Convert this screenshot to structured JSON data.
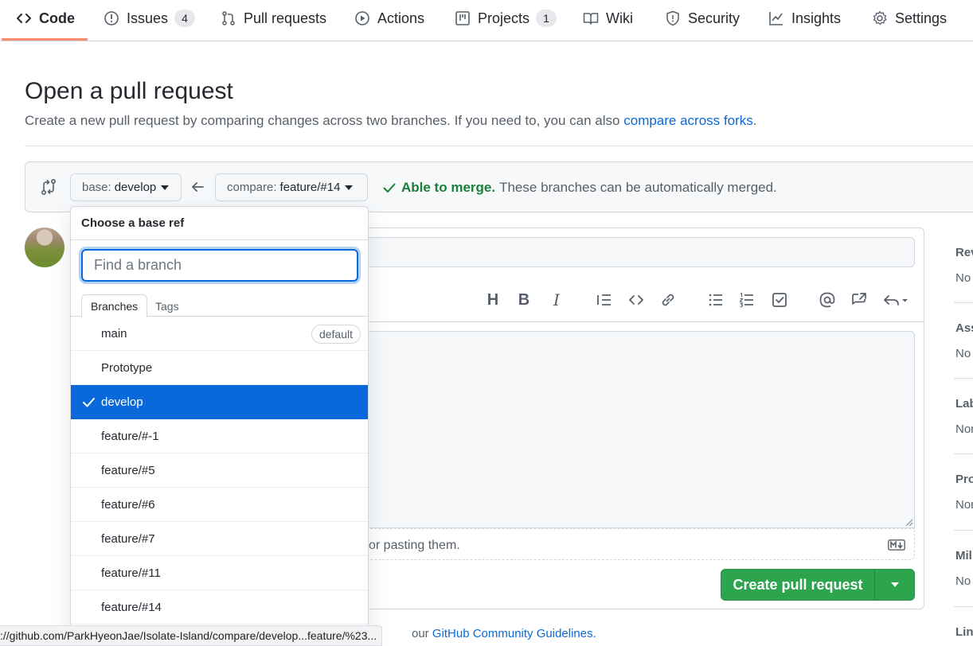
{
  "repo_nav": {
    "tabs": [
      {
        "label": "Code",
        "icon": "code-icon",
        "active": true
      },
      {
        "label": "Issues",
        "icon": "issue-icon",
        "count": "4"
      },
      {
        "label": "Pull requests",
        "icon": "pull-request-icon"
      },
      {
        "label": "Actions",
        "icon": "play-icon"
      },
      {
        "label": "Projects",
        "icon": "project-icon",
        "count": "1"
      },
      {
        "label": "Wiki",
        "icon": "book-icon"
      },
      {
        "label": "Security",
        "icon": "shield-icon"
      },
      {
        "label": "Insights",
        "icon": "graph-icon"
      },
      {
        "label": "Settings",
        "icon": "gear-icon"
      }
    ]
  },
  "header": {
    "title": "Open a pull request",
    "subtitle": "Create a new pull request by comparing changes across two branches. If you need to, you can also",
    "subtitle_link": "compare across forks",
    "subtitle_end": "."
  },
  "range": {
    "base_prefix": "base:",
    "base_branch": "develop",
    "compare_prefix": "compare:",
    "compare_branch": "feature/#14",
    "merge_ok": "Able to merge.",
    "merge_text": "These branches can be automatically merged."
  },
  "dropdown": {
    "title": "Choose a base ref",
    "filter_placeholder": "Find a branch",
    "tabs": [
      "Branches",
      "Tags"
    ],
    "default_badge": "default",
    "items": [
      "main",
      "Prototype",
      "develop",
      "feature/#-1",
      "feature/#5",
      "feature/#6",
      "feature/#7",
      "feature/#11",
      "feature/#14"
    ],
    "selected": "develop"
  },
  "composer": {
    "attach_hint": "or pasting them.",
    "create_button": "Create pull request"
  },
  "footer": {
    "guidelines_prefix": "our",
    "guidelines_link": "GitHub Community Guidelines."
  },
  "sidebar": {
    "sections": [
      {
        "head": "Rev",
        "value": "No"
      },
      {
        "head": "Ass",
        "value": "No"
      },
      {
        "head": "Lab",
        "value": "Nor"
      },
      {
        "head": "Pro",
        "value": "Nor"
      },
      {
        "head": "Mil",
        "value": "No"
      },
      {
        "head": "Lin",
        "value": ""
      }
    ]
  },
  "status_bar": {
    "url": "://github.com/ParkHyeonJae/Isolate-Island/compare/develop...feature/%23..."
  },
  "colors": {
    "accent": "#0969da",
    "success": "#2da44e",
    "nav_underline": "#fd8c73"
  }
}
